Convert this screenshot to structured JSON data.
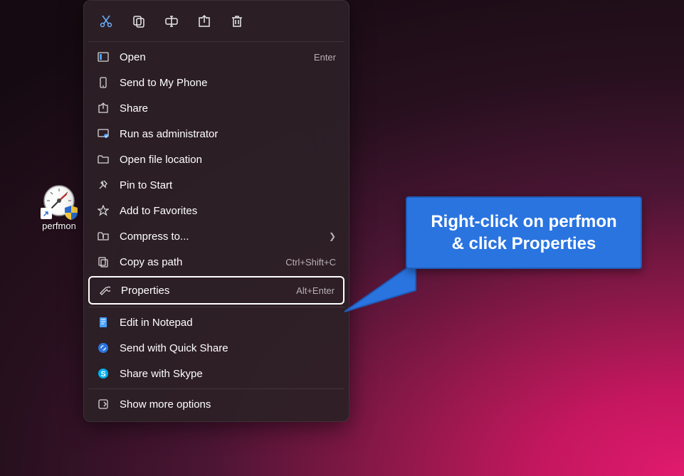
{
  "desktop_icon": {
    "label": "perfmon"
  },
  "context_menu": {
    "toolbar": [
      {
        "name": "cut"
      },
      {
        "name": "copy"
      },
      {
        "name": "rename"
      },
      {
        "name": "share"
      },
      {
        "name": "delete"
      }
    ],
    "group1": [
      {
        "icon": "open",
        "label": "Open",
        "accel": "Enter"
      },
      {
        "icon": "phone",
        "label": "Send to My Phone"
      },
      {
        "icon": "share",
        "label": "Share"
      },
      {
        "icon": "admin",
        "label": "Run as administrator"
      },
      {
        "icon": "folder",
        "label": "Open file location"
      },
      {
        "icon": "pin",
        "label": "Pin to Start"
      },
      {
        "icon": "star",
        "label": "Add to Favorites"
      },
      {
        "icon": "compress",
        "label": "Compress to...",
        "submenu": true
      },
      {
        "icon": "copypath",
        "label": "Copy as path",
        "accel": "Ctrl+Shift+C"
      }
    ],
    "highlight": {
      "icon": "wrench",
      "label": "Properties",
      "accel": "Alt+Enter"
    },
    "group2": [
      {
        "icon": "notepad",
        "label": "Edit in Notepad"
      },
      {
        "icon": "quickshare",
        "label": "Send with Quick Share"
      },
      {
        "icon": "skype",
        "label": "Share with Skype"
      }
    ],
    "more": {
      "icon": "more",
      "label": "Show more options"
    }
  },
  "callout": {
    "line1": "Right-click on perfmon",
    "line2": "& click Properties"
  }
}
